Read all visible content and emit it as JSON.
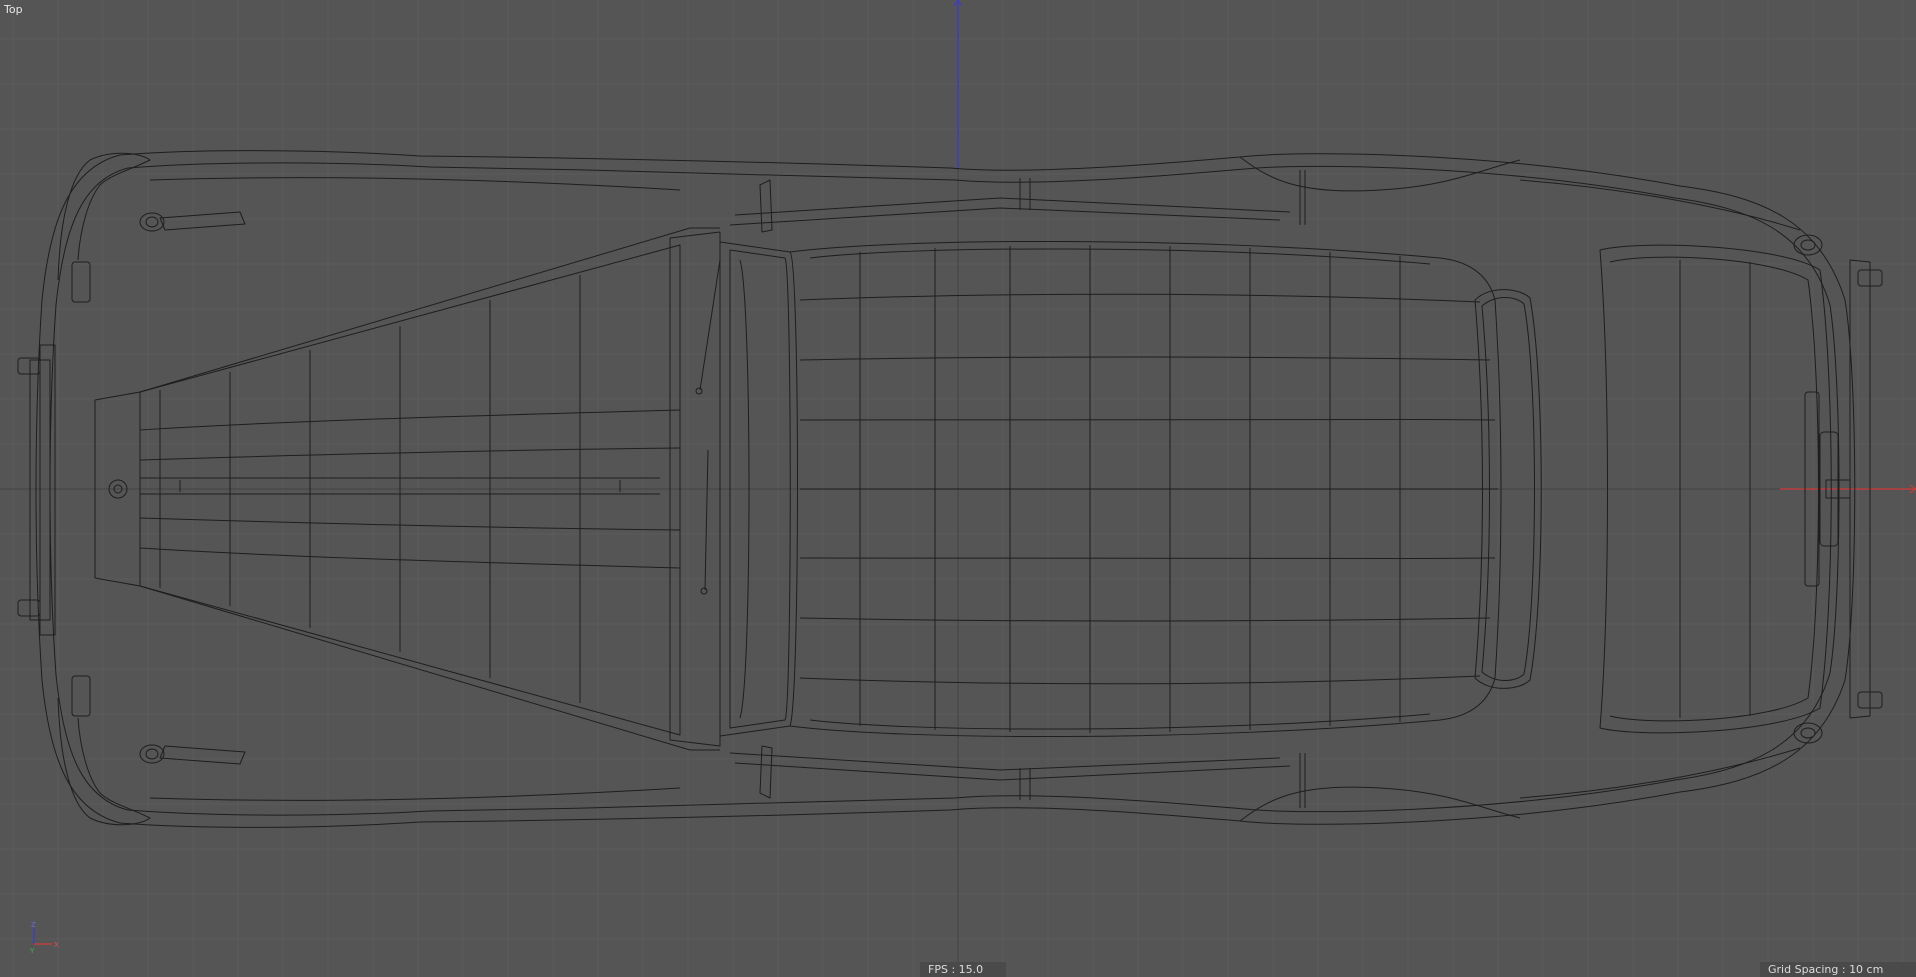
{
  "viewport": {
    "view_name": "Top",
    "fps_label": "FPS",
    "fps_value": "15.0",
    "grid_spacing_label": "Grid Spacing",
    "grid_spacing_value": "10 cm",
    "projection": "orthographic top view",
    "background_color": "#555555",
    "grid_color": "#5c5c5c",
    "axis_colors": {
      "x": "#d43b3b",
      "y": "#3aa63a",
      "z": "#3a3ad4"
    }
  },
  "gizmo": {
    "x_label": "X",
    "y_label": "Y",
    "z_label": "Z"
  },
  "object": {
    "icon": "car-wireframe-icon"
  }
}
